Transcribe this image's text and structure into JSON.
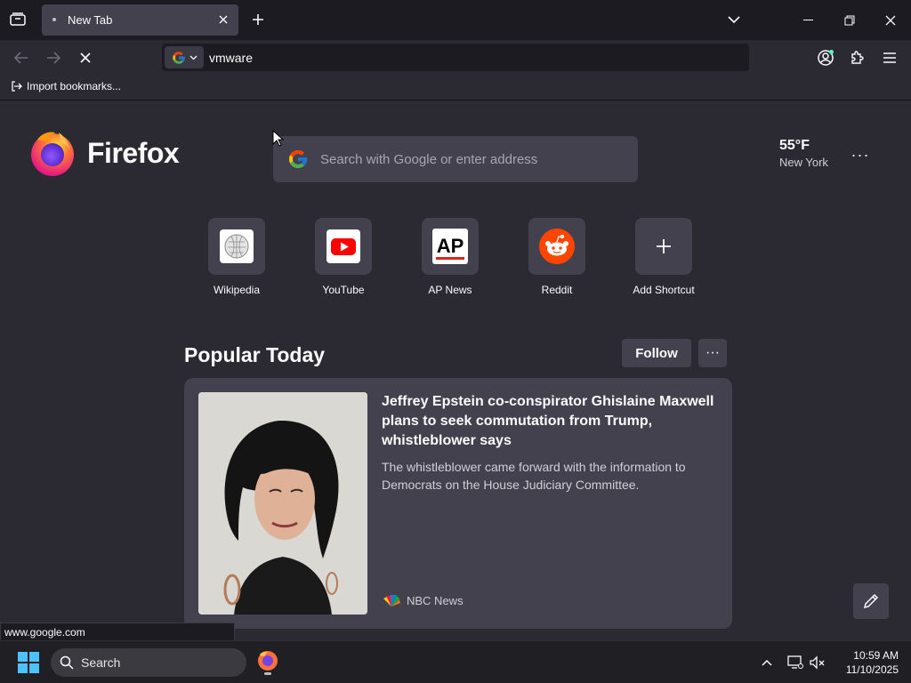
{
  "tabbar": {
    "tab_title": "New Tab"
  },
  "navbar": {
    "url_value": "vmware"
  },
  "bookmarks": {
    "import_label": "Import bookmarks..."
  },
  "newtab": {
    "logo_text": "Firefox",
    "search_placeholder": "Search with Google or enter address",
    "weather": {
      "temp": "55°F",
      "city": "New York"
    },
    "shortcuts": [
      {
        "label": "Wikipedia",
        "icon": "wikipedia-icon"
      },
      {
        "label": "YouTube",
        "icon": "youtube-icon"
      },
      {
        "label": "AP News",
        "icon": "ap-news-icon"
      },
      {
        "label": "Reddit",
        "icon": "reddit-icon"
      },
      {
        "label": "Add Shortcut",
        "icon": "plus-icon"
      }
    ],
    "popular": {
      "title": "Popular Today",
      "follow_label": "Follow",
      "more_label": "···",
      "card": {
        "headline": "Jeffrey Epstein co-conspirator Ghislaine Maxwell plans to seek commutation from Trump, whistleblower says",
        "description": "The whistleblower came forward with the information to Democrats on the House Judiciary Committee.",
        "source": "NBC News"
      }
    }
  },
  "status": {
    "link_url": "www.google.com"
  },
  "taskbar": {
    "search_label": "Search",
    "time": "10:59 AM",
    "date": "11/10/2025"
  },
  "colors": {
    "page_bg": "#2b2a33",
    "tile_bg": "#42414d",
    "chrome_bg": "#1c1b22",
    "accent": "#0060df"
  }
}
